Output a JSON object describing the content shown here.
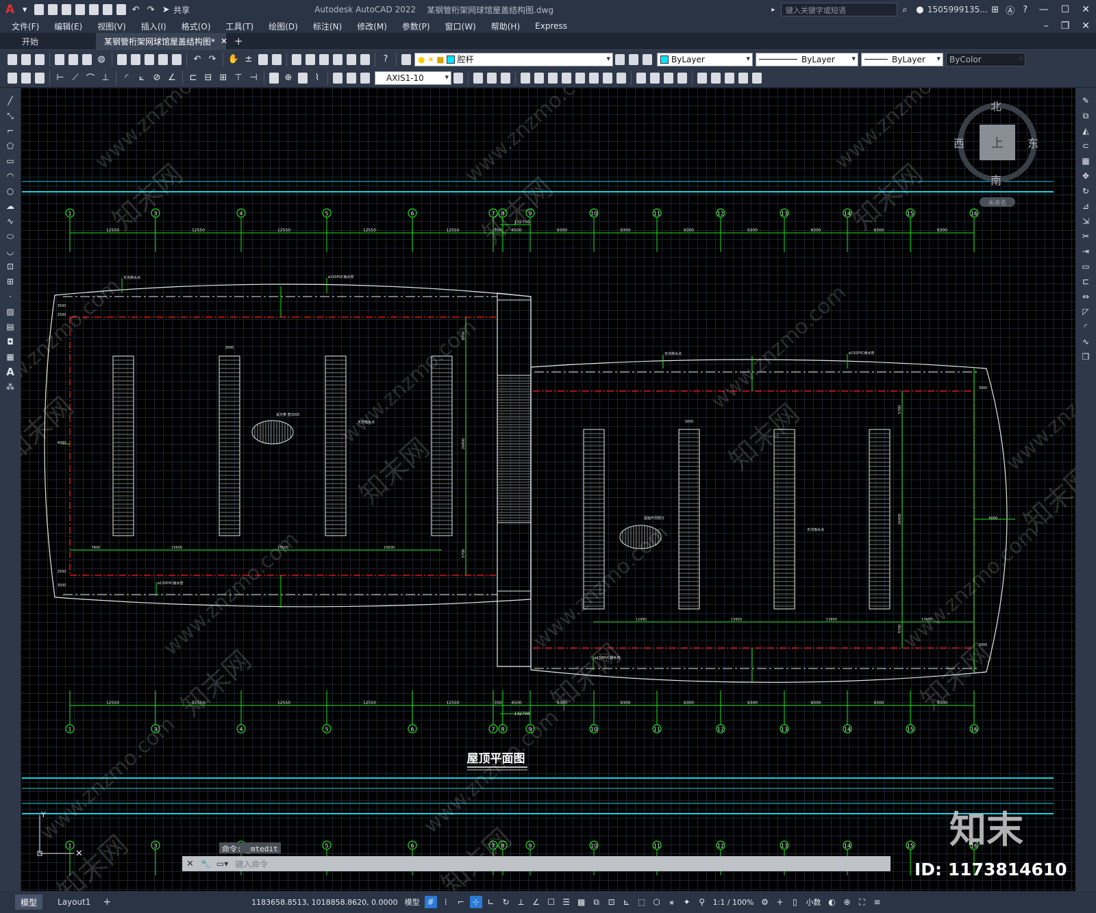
{
  "app": {
    "title": "Autodesk AutoCAD 2022",
    "file_name": "某钢管桁架网球馆屋盖结构图.dwg",
    "share_label": "共享",
    "search_placeholder": "键入关键字或短语",
    "user": "1505999135...",
    "logo": "A"
  },
  "menu": [
    "文件(F)",
    "编辑(E)",
    "视图(V)",
    "插入(I)",
    "格式(O)",
    "工具(T)",
    "绘图(D)",
    "标注(N)",
    "修改(M)",
    "参数(P)",
    "窗口(W)",
    "帮助(H)",
    "Express"
  ],
  "tabs": [
    {
      "label": "开始"
    },
    {
      "label": "某钢管桁架网球馆屋盖结构图*"
    }
  ],
  "layer": {
    "name": "腔杆",
    "color": "#00e5ff"
  },
  "properties": {
    "color": "ByLayer",
    "linetype": "ByLayer",
    "lineweight": "ByLayer",
    "plotstyle": "ByColor"
  },
  "dimstyle": "AXIS1-10",
  "viewcube": {
    "north": "北",
    "south": "南",
    "east": "东",
    "west": "西",
    "top": "上",
    "ucs_label": "未命名"
  },
  "drawing": {
    "title": "屋顶平面图",
    "axes": [
      "1",
      "3",
      "4",
      "5",
      "6",
      "7",
      "8",
      "9",
      "10",
      "11",
      "12",
      "13",
      "14",
      "15",
      "16"
    ],
    "dims_top": [
      "12550",
      "12550",
      "12550",
      "12550",
      "12550",
      "350",
      "4500",
      "9300",
      "9300",
      "9300",
      "9300",
      "9300",
      "9300",
      "9300"
    ],
    "total_dim": "132700",
    "left_dims": [
      "3500",
      "2500",
      "4000",
      "2500",
      "3500"
    ],
    "left_inner": [
      "7800",
      "15600",
      "15600",
      "15600"
    ],
    "right_inner": [
      "11950",
      "13950",
      "13950",
      "13950"
    ],
    "vertical": [
      "5700",
      "26400",
      "5700",
      "3900",
      "6000",
      "3000",
      "2500"
    ],
    "labels": {
      "pvc": "ø150PVC雨水管",
      "gutter": "天沟排水点",
      "skylight": "采光带 宽3000",
      "opening": "屋面开洞部分",
      "roof_drain": "天沟落水点"
    },
    "width_3000": "3000"
  },
  "command": {
    "history": "命令: _mtedit",
    "placeholder": "键入命令"
  },
  "layouts": [
    "模型",
    "Layout1"
  ],
  "status": {
    "coords": "1183658.8513, 1018858.8620, 0.0000",
    "model": "模型",
    "scale": "1:1 / 100%",
    "units": "小数"
  },
  "watermark": {
    "brand": "知末",
    "id": "ID: 1173814610",
    "site": "www.znzmo.com",
    "cn": "知末网"
  },
  "colors": {
    "cyan": "#19d3e0",
    "green": "#1ee61e",
    "red": "#e01414",
    "white": "#e8e8e8"
  }
}
